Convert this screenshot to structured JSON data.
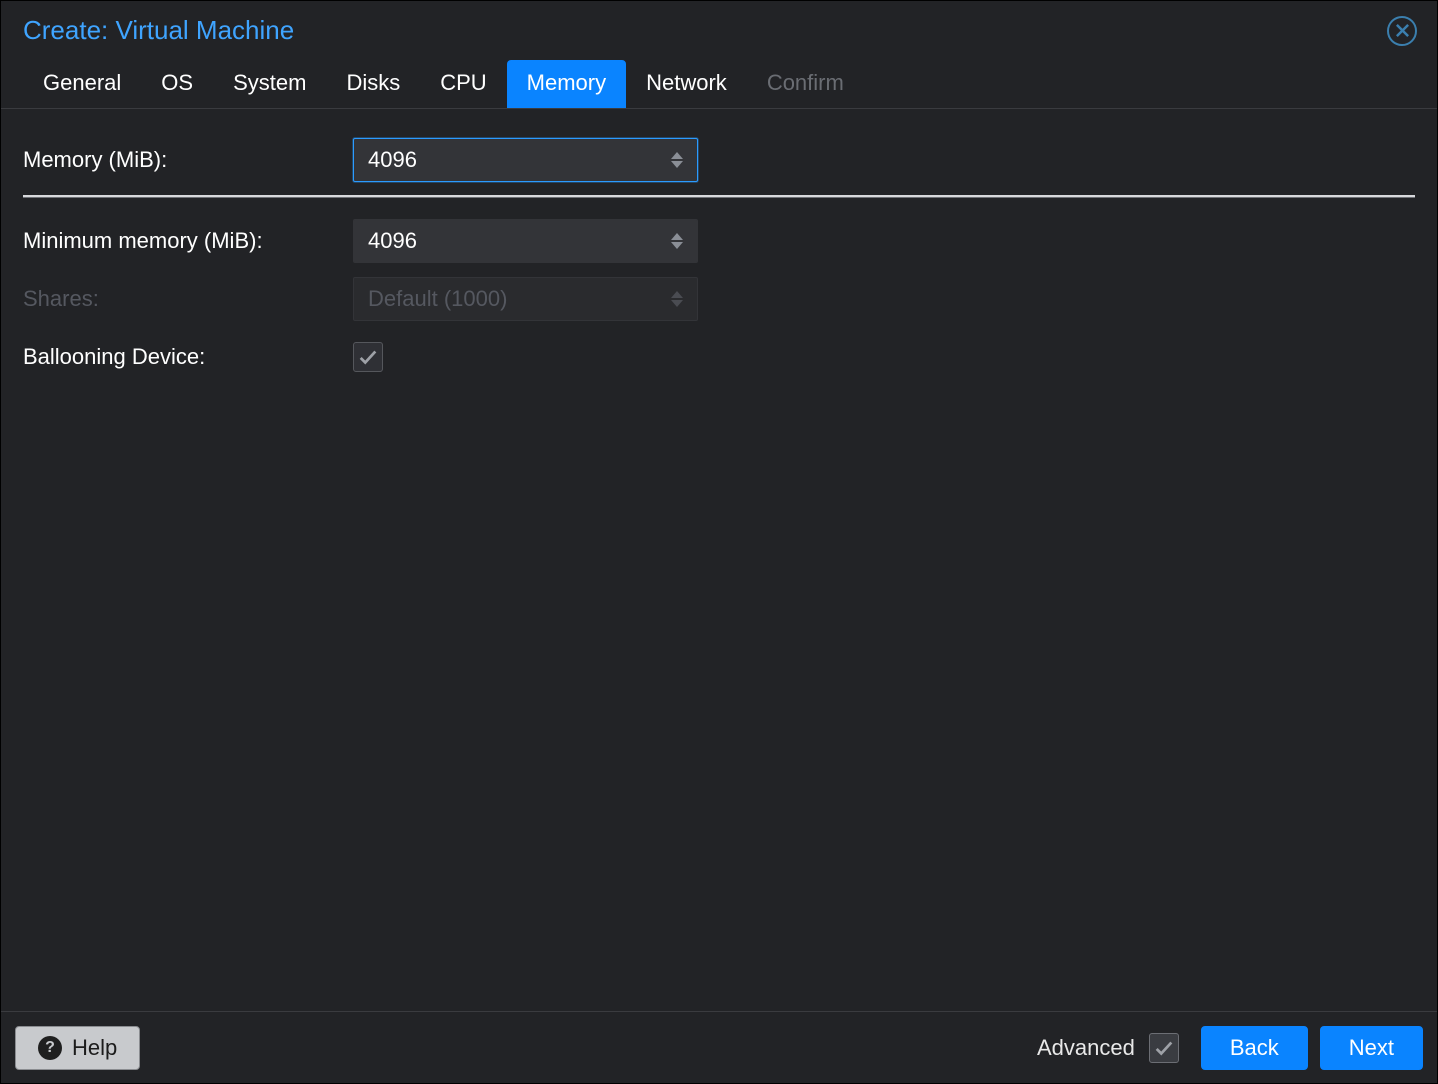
{
  "window": {
    "title": "Create: Virtual Machine"
  },
  "tabs": [
    {
      "label": "General",
      "active": false,
      "disabled": false
    },
    {
      "label": "OS",
      "active": false,
      "disabled": false
    },
    {
      "label": "System",
      "active": false,
      "disabled": false
    },
    {
      "label": "Disks",
      "active": false,
      "disabled": false
    },
    {
      "label": "CPU",
      "active": false,
      "disabled": false
    },
    {
      "label": "Memory",
      "active": true,
      "disabled": false
    },
    {
      "label": "Network",
      "active": false,
      "disabled": false
    },
    {
      "label": "Confirm",
      "active": false,
      "disabled": true
    }
  ],
  "form": {
    "memory_label": "Memory (MiB):",
    "memory_value": "4096",
    "min_memory_label": "Minimum memory (MiB):",
    "min_memory_value": "4096",
    "shares_label": "Shares:",
    "shares_value": "Default (1000)",
    "ballooning_label": "Ballooning Device:",
    "ballooning_checked": true
  },
  "footer": {
    "help": "Help",
    "advanced_label": "Advanced",
    "advanced_checked": true,
    "back": "Back",
    "next": "Next"
  }
}
